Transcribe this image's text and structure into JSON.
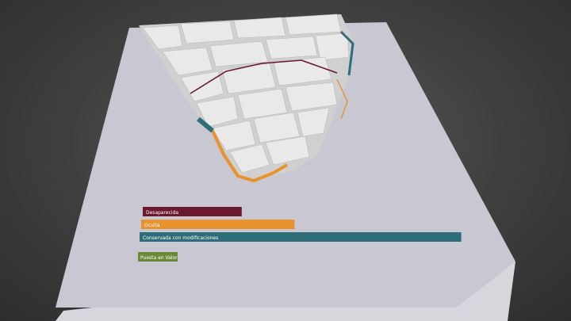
{
  "legend": {
    "items": [
      {
        "label": "Desaparecida",
        "color": "#6b1a2e",
        "value": 1.0
      },
      {
        "label": "Oculta",
        "color": "#e8922e",
        "value": 1.55
      },
      {
        "label": "Conservada con modificaciones",
        "color": "#2e6e78",
        "value": 3.25
      },
      {
        "label": "Puesta en Valor",
        "color": "#6b8a3a",
        "value": 0.33
      }
    ]
  },
  "colors": {
    "base_top": "#c9c8d3",
    "base_side": "#d8d7de",
    "buildings": "#e6e6e6",
    "building_shadow": "#bdbdbd"
  }
}
